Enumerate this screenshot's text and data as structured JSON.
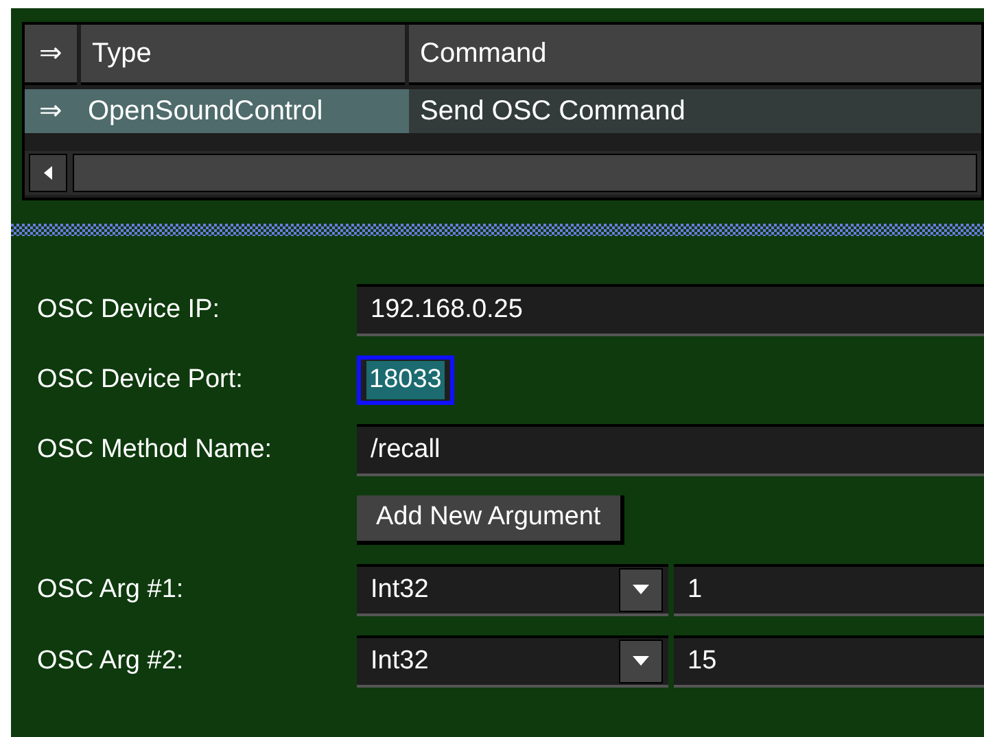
{
  "table": {
    "columns": [
      "⇒",
      "Type",
      "Command"
    ],
    "rows": [
      {
        "cells": [
          "⇒",
          "OpenSoundControl",
          "Send OSC Command"
        ],
        "selected": true
      }
    ]
  },
  "form": {
    "fields": [
      {
        "label": "OSC Device IP:",
        "kind": "text",
        "value": "192.168.0.25",
        "focused": false
      },
      {
        "label": "OSC Device Port:",
        "kind": "text",
        "value": "18033",
        "focused": true
      },
      {
        "label": "OSC Method Name:",
        "kind": "text",
        "value": "/recall",
        "focused": false
      },
      {
        "kind": "button",
        "text": "Add New Argument"
      },
      {
        "label": "OSC Arg #1:",
        "kind": "argument",
        "type": "Int32",
        "value": "1"
      },
      {
        "label": "OSC Arg #2:",
        "kind": "argument",
        "type": "Int32",
        "value": "15"
      }
    ]
  }
}
